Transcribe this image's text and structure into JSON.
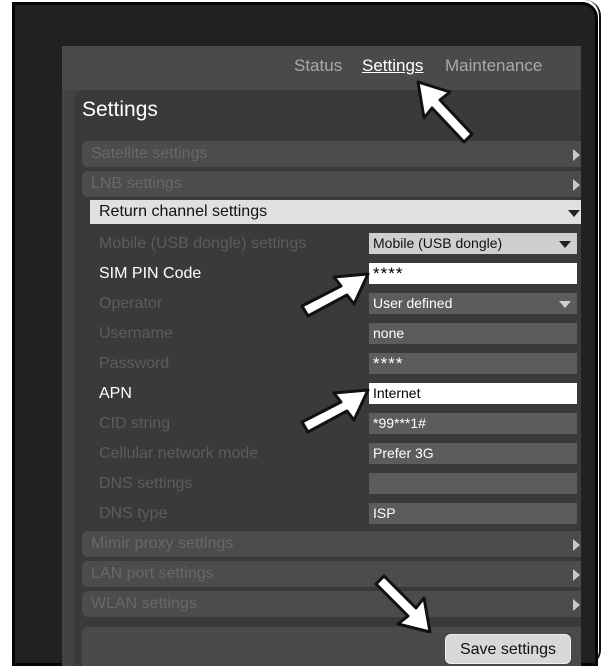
{
  "nav": {
    "status": "Status",
    "settings": "Settings",
    "maintenance": "Maintenance"
  },
  "panel_title": "Settings",
  "sections": [
    {
      "label": "Satellite settings"
    },
    {
      "label": "LNB settings"
    },
    {
      "label": "Return channel settings"
    },
    {
      "label": "Mimir proxy settings"
    },
    {
      "label": "LAN port settings"
    },
    {
      "label": "WLAN settings"
    }
  ],
  "return_channel": {
    "fields": [
      {
        "label": "Mobile (USB dongle) settings",
        "value": "Mobile (USB dongle)"
      },
      {
        "label": "SIM PIN Code",
        "value": "****"
      },
      {
        "label": "Operator",
        "value": "User defined"
      },
      {
        "label": "Username",
        "value": "none"
      },
      {
        "label": "Password",
        "value": "****"
      },
      {
        "label": "APN",
        "value": "Internet"
      },
      {
        "label": "CID string",
        "value": "*99***1#"
      },
      {
        "label": "Cellular network mode",
        "value": "Prefer 3G"
      },
      {
        "label": "DNS settings",
        "value": ""
      },
      {
        "label": "DNS type",
        "value": "ISP"
      }
    ]
  },
  "save_button": "Save settings",
  "colors": {
    "frame": "#212121",
    "screen": "#434343",
    "panel": "#3a3a3a",
    "expanded_row": "#e0e0e0",
    "active_field": "#ffffff"
  },
  "icons": [
    "arrow-pointer-icon",
    "chevron-right-icon",
    "chevron-down-icon"
  ]
}
